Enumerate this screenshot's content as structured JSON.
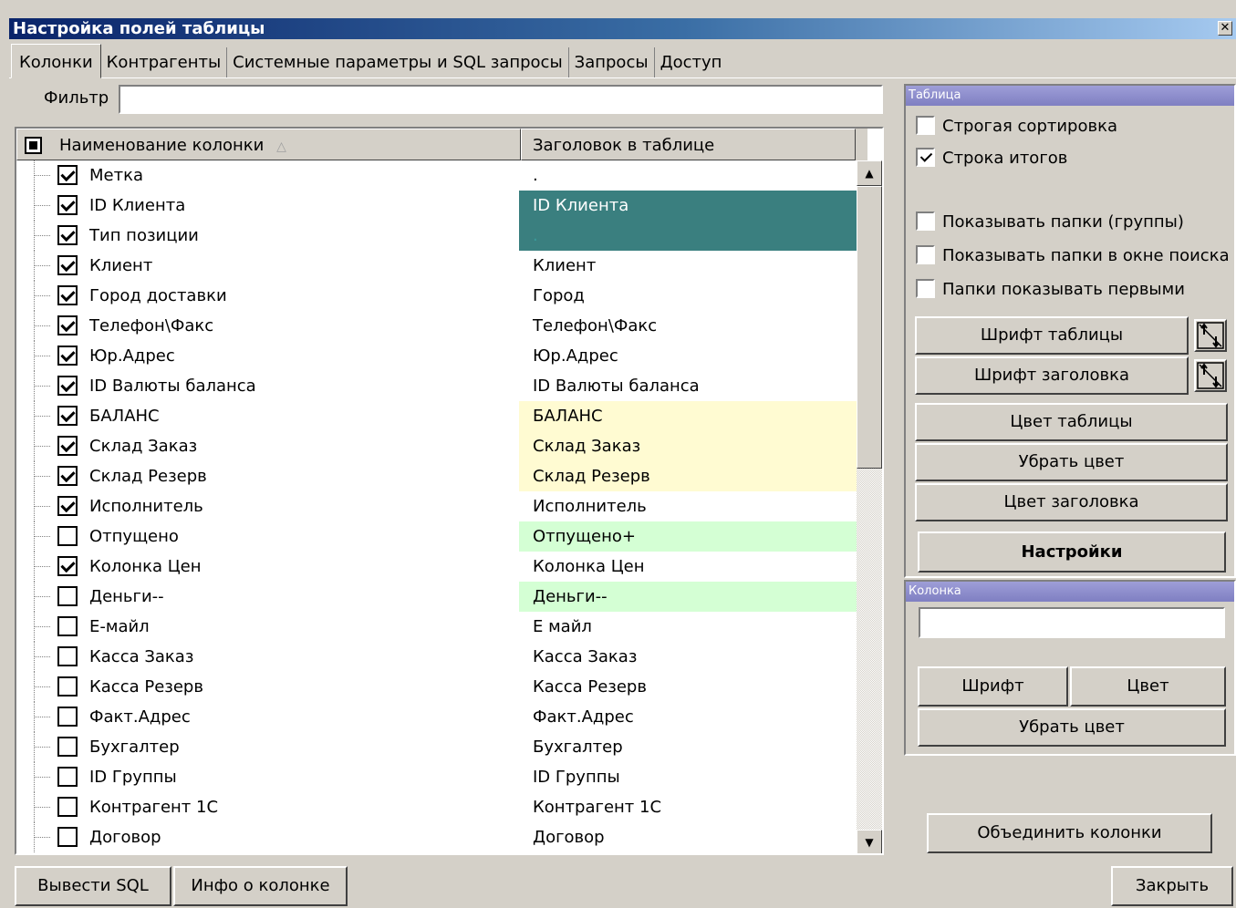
{
  "window": {
    "title": "Настройка полей таблицы",
    "close_glyph": "✕"
  },
  "tabs": [
    {
      "label": "Колонки",
      "active": true
    },
    {
      "label": "Контрагенты",
      "active": false
    },
    {
      "label": "Системные параметры и SQL запросы",
      "active": false
    },
    {
      "label": "Запросы",
      "active": false
    },
    {
      "label": "Доступ",
      "active": false
    }
  ],
  "filter": {
    "label": "Фильтр",
    "value": ""
  },
  "grid": {
    "columns": {
      "name": "Наименование колонки",
      "title": "Заголовок в таблице"
    },
    "sort_glyph": "△",
    "rows": [
      {
        "name": "Метка",
        "title": ".",
        "checked": true,
        "bg": "#ffffff",
        "fg": "#000000"
      },
      {
        "name": "ID Клиента",
        "title": "ID Клиента",
        "checked": true,
        "bg": "#3a7f7f",
        "fg": "#ffffff"
      },
      {
        "name": "Тип позиции",
        "title": ".",
        "checked": true,
        "bg": "#3a7f7f",
        "fg": "#3a9a9a"
      },
      {
        "name": "Клиент",
        "title": "Клиент",
        "checked": true,
        "bg": "#ffffff",
        "fg": "#000000"
      },
      {
        "name": "Город доставки",
        "title": "Город",
        "checked": true,
        "bg": "#ffffff",
        "fg": "#000000"
      },
      {
        "name": "Телефон\\Факс",
        "title": "Телефон\\Факс",
        "checked": true,
        "bg": "#ffffff",
        "fg": "#000000"
      },
      {
        "name": "Юр.Адрес",
        "title": "Юр.Адрес",
        "checked": true,
        "bg": "#ffffff",
        "fg": "#000000"
      },
      {
        "name": "ID Валюты баланса",
        "title": "ID Валюты баланса",
        "checked": true,
        "bg": "#ffffff",
        "fg": "#000000"
      },
      {
        "name": "БАЛАНС",
        "title": "БАЛАНС",
        "checked": true,
        "bg": "#fffbd2",
        "fg": "#000000"
      },
      {
        "name": "Склад Заказ",
        "title": "Склад Заказ",
        "checked": true,
        "bg": "#fffbd2",
        "fg": "#000000"
      },
      {
        "name": "Склад Резерв",
        "title": "Склад Резерв",
        "checked": true,
        "bg": "#fffbd2",
        "fg": "#000000"
      },
      {
        "name": "Исполнитель",
        "title": "Исполнитель",
        "checked": true,
        "bg": "#ffffff",
        "fg": "#000000"
      },
      {
        "name": "Отпущено",
        "title": "Отпущено+",
        "checked": false,
        "bg": "#d4ffd4",
        "fg": "#000000"
      },
      {
        "name": "Колонка Цен",
        "title": "Колонка Цен",
        "checked": true,
        "bg": "#ffffff",
        "fg": "#000000"
      },
      {
        "name": "Деньги--",
        "title": "Деньги--",
        "checked": false,
        "bg": "#d4ffd4",
        "fg": "#000000"
      },
      {
        "name": "Е-майл",
        "title": "Е майл",
        "checked": false,
        "bg": "#ffffff",
        "fg": "#000000"
      },
      {
        "name": "Касса Заказ",
        "title": "Касса Заказ",
        "checked": false,
        "bg": "#ffffff",
        "fg": "#000000"
      },
      {
        "name": "Касса Резерв",
        "title": "Касса Резерв",
        "checked": false,
        "bg": "#ffffff",
        "fg": "#000000"
      },
      {
        "name": "Факт.Адрес",
        "title": "Факт.Адрес",
        "checked": false,
        "bg": "#ffffff",
        "fg": "#000000"
      },
      {
        "name": "Бухгалтер",
        "title": "Бухгалтер",
        "checked": false,
        "bg": "#ffffff",
        "fg": "#000000"
      },
      {
        "name": "ID Группы",
        "title": "ID Группы",
        "checked": false,
        "bg": "#ffffff",
        "fg": "#000000"
      },
      {
        "name": "Контрагент 1С",
        "title": "Контрагент 1С",
        "checked": false,
        "bg": "#ffffff",
        "fg": "#000000"
      },
      {
        "name": "Договор",
        "title": "Договор",
        "checked": false,
        "bg": "#ffffff",
        "fg": "#000000"
      }
    ]
  },
  "table_group": {
    "title": "Таблица",
    "strict_sort": {
      "label": "Строгая сортировка",
      "checked": false
    },
    "totals_row": {
      "label": "Строка итогов",
      "checked": true
    },
    "show_folders": {
      "label": "Показывать папки (группы)",
      "checked": false
    },
    "show_folders_search": {
      "label": "Показывать папки в окне поиска",
      "checked": false
    },
    "folders_first": {
      "label": "Папки показывать первыми",
      "checked": false
    },
    "font_table": "Шрифт таблицы",
    "font_header": "Шрифт заголовка",
    "color_table": "Цвет таблицы",
    "remove_color": "Убрать цвет",
    "color_header": "Цвет заголовка",
    "settings": "Настройки"
  },
  "column_group": {
    "title": "Колонка",
    "value": "",
    "font": "Шрифт",
    "color": "Цвет",
    "remove_color": "Убрать цвет"
  },
  "merge_columns": "Объединить колонки",
  "footer": {
    "sql": "Вывести SQL",
    "info": "Инфо о колонке",
    "close": "Закрыть"
  }
}
